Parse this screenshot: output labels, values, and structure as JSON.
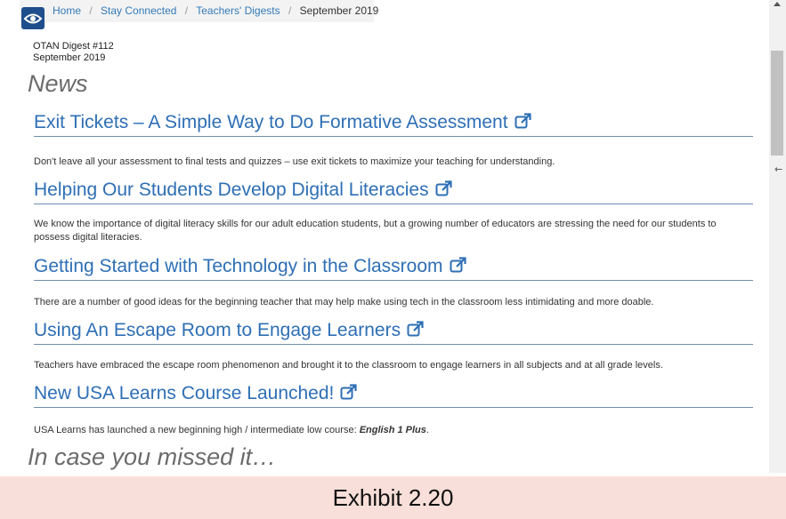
{
  "breadcrumb": [
    "Home",
    "Stay Connected",
    "Teachers' Digests",
    "September 2019"
  ],
  "breadcrumb_separator": "/",
  "digest": {
    "number": "OTAN Digest #112",
    "date": "September 2019"
  },
  "news_heading": "News",
  "articles": [
    {
      "title": "Exit Tickets – A Simple Way to Do Formative Assessment",
      "desc": "Don't leave all your assessment to final tests and quizzes – use exit tickets to maximize your teaching for understanding."
    },
    {
      "title": "Helping Our Students Develop Digital Literacies",
      "desc": "We know the importance of digital literacy skills for our adult education students, but a growing number of educators are stressing the need for our students to possess digital literacies."
    },
    {
      "title": "Getting Started with Technology in the Classroom",
      "desc": "There are a number of good ideas for the beginning teacher that may help make using tech in the classroom less intimidating and more doable."
    },
    {
      "title": "Using An Escape Room to Engage Learners",
      "desc": "Teachers have embraced the escape room phenomenon and brought it to the classroom to engage learners in all subjects and at all grade levels."
    },
    {
      "title": "New USA Learns Course Launched!",
      "desc_prefix": "USA Learns has launched a new beginning high / intermediate low course: ",
      "desc_emphasis": "English 1 Plus",
      "desc_suffix": "."
    }
  ],
  "missed_heading": "In case you missed it…",
  "exhibit_label": "Exhibit 2.20",
  "colors": {
    "link": "#2e6fb5",
    "logo": "#1f4e8c",
    "caption_bg": "#f9dfd9",
    "heading": "#6b6b6b"
  },
  "icons": {
    "logo": "otan-logo-icon",
    "external": "external-link-icon"
  }
}
